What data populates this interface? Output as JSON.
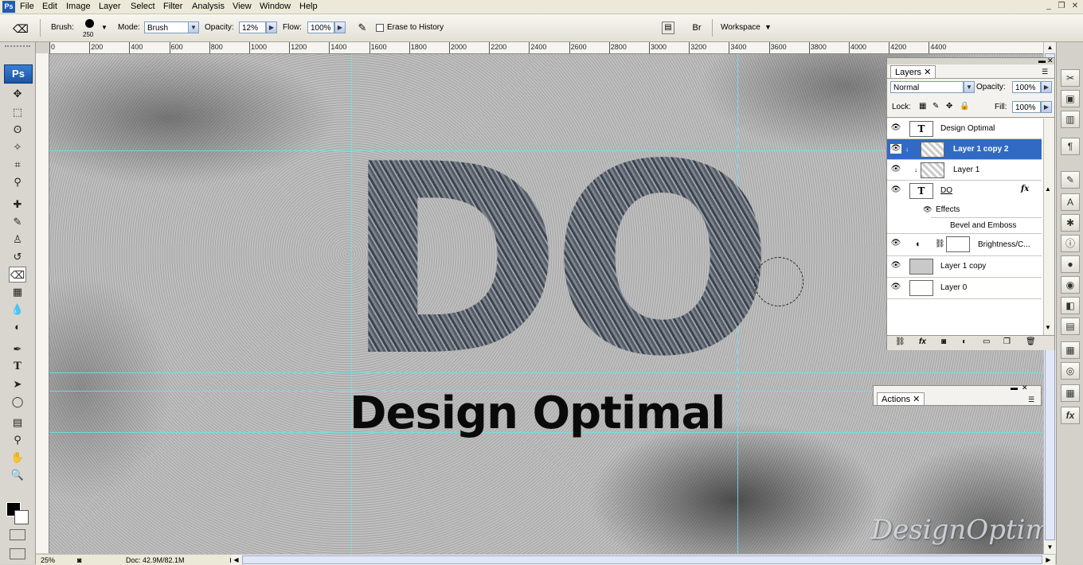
{
  "app": {
    "logo": "Ps"
  },
  "menu": [
    "File",
    "Edit",
    "Image",
    "Layer",
    "Select",
    "Filter",
    "Analysis",
    "View",
    "Window",
    "Help"
  ],
  "window_controls": {
    "minimize": "_",
    "restore": "❐",
    "close": "✕"
  },
  "options": {
    "brush_label": "Brush:",
    "brush_size": "250",
    "mode_label": "Mode:",
    "mode_value": "Brush",
    "opacity_label": "Opacity:",
    "opacity_value": "12%",
    "flow_label": "Flow:",
    "flow_value": "100%",
    "erase_history_label": "Erase to History",
    "erase_history_checked": false,
    "workspace_label": "Workspace"
  },
  "ruler_top_labels": [
    "0",
    "200",
    "400",
    "600",
    "800",
    "1000",
    "1200",
    "1400",
    "1600",
    "1800",
    "2000",
    "2200",
    "2400",
    "2600",
    "2800",
    "3000",
    "3200",
    "3400",
    "3600",
    "3800",
    "4000",
    "4200",
    "4400"
  ],
  "canvas": {
    "big_text": "DO",
    "subtitle": "Design Optimal",
    "watermark": "DesignOptimal.com"
  },
  "status": {
    "zoom": "25%",
    "doc": "Doc: 42.9M/82.1M"
  },
  "layers_panel": {
    "tab": "Layers",
    "blend_mode": "Normal",
    "opacity_label": "Opacity:",
    "opacity_value": "100%",
    "lock_label": "Lock:",
    "fill_label": "Fill:",
    "fill_value": "100%",
    "layers": [
      {
        "name": "Design Optimal",
        "type": "text",
        "selected": false
      },
      {
        "name": "Layer 1 copy 2",
        "type": "pixel",
        "selected": true
      },
      {
        "name": "Layer 1",
        "type": "pixel",
        "selected": false
      },
      {
        "name": "DO",
        "type": "text",
        "selected": false,
        "fx": "fx"
      },
      {
        "name": "Effects",
        "type": "effects",
        "selected": false
      },
      {
        "name": "Bevel and Emboss",
        "type": "effect",
        "selected": false
      },
      {
        "name": "Brightness/C...",
        "type": "adjustment",
        "selected": false
      },
      {
        "name": "Layer 1 copy",
        "type": "pixel",
        "selected": false
      },
      {
        "name": "Layer 0",
        "type": "pixel",
        "selected": false
      }
    ]
  },
  "actions_panel": {
    "tab": "Actions"
  },
  "colors": {
    "guide": "#6ee0e8",
    "selection": "#316ac5",
    "ps_blue": "#1c5fb0"
  },
  "icons": {
    "tools": [
      "move-icon",
      "marquee-icon",
      "lasso-icon",
      "magic-wand-icon",
      "crop-icon",
      "eyedropper-icon",
      "healing-brush-icon",
      "brush-icon",
      "clone-stamp-icon",
      "history-brush-icon",
      "eraser-icon",
      "gradient-icon",
      "blur-icon",
      "dodge-icon",
      "pen-icon",
      "type-icon",
      "path-selection-icon",
      "ellipse-icon",
      "notes-icon",
      "eyedropper2-icon",
      "hand-icon",
      "zoom-icon"
    ]
  }
}
